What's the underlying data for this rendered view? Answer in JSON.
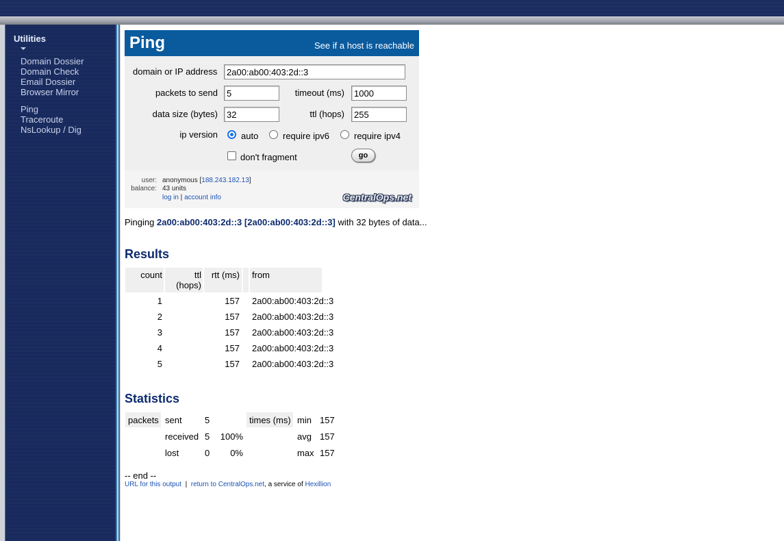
{
  "sidebar": {
    "heading": "Utilities",
    "group1": [
      "Domain Dossier",
      "Domain Check",
      "Email Dossier",
      "Browser Mirror"
    ],
    "group2": [
      "Ping",
      "Traceroute",
      "NsLookup / Dig"
    ]
  },
  "ping_form": {
    "title": "Ping",
    "tagline": "See if a host is reachable",
    "host_label": "domain or IP address",
    "host_value": "2a00:ab00:403:2d::3",
    "packets_label": "packets to send",
    "packets_value": "5",
    "timeout_label": "timeout (ms)",
    "timeout_value": "1000",
    "size_label": "data size (bytes)",
    "size_value": "32",
    "ttl_label": "ttl (hops)",
    "ttl_value": "255",
    "ipver_label": "ip version",
    "ipver_options": [
      "auto",
      "require ipv6",
      "require ipv4"
    ],
    "ipver_selected": "auto",
    "dontfrag_label": "don't fragment",
    "dontfrag_checked": false,
    "go_label": "go"
  },
  "user_panel": {
    "user_label": "user:",
    "user_name": "anonymous",
    "user_ip": "188.243.182.13",
    "balance_label": "balance:",
    "balance_value": "43 units",
    "login_link": "log in",
    "account_link": "account info",
    "logo_text": "CentralOps.net"
  },
  "pinging_line": {
    "prefix": "Pinging",
    "host": "2a00:ab00:403:2d::3",
    "addr": "[2a00:ab00:403:2d::3]",
    "suffix": "with 32 bytes of data..."
  },
  "results": {
    "title": "Results",
    "headers": {
      "count": "count",
      "ttl_1": "ttl",
      "ttl_2": "(hops)",
      "rtt": "rtt (ms)",
      "from": "from"
    },
    "rows": [
      {
        "count": "1",
        "rtt": "157",
        "from": "2a00:ab00:403:2d::3"
      },
      {
        "count": "2",
        "rtt": "157",
        "from": "2a00:ab00:403:2d::3"
      },
      {
        "count": "3",
        "rtt": "157",
        "from": "2a00:ab00:403:2d::3"
      },
      {
        "count": "4",
        "rtt": "157",
        "from": "2a00:ab00:403:2d::3"
      },
      {
        "count": "5",
        "rtt": "157",
        "from": "2a00:ab00:403:2d::3"
      }
    ]
  },
  "statistics": {
    "title": "Statistics",
    "packets_header": "packets",
    "times_header": "times (ms)",
    "sent_label": "sent",
    "sent_value": "5",
    "received_label": "received",
    "received_value": "5",
    "received_pct": "100%",
    "lost_label": "lost",
    "lost_value": "0",
    "lost_pct": "0%",
    "min_label": "min",
    "min_value": "157",
    "avg_label": "avg",
    "avg_value": "157",
    "max_label": "max",
    "max_value": "157"
  },
  "footer": {
    "end_text": "-- end --",
    "url_link": "URL for this output",
    "sep": "|",
    "return_link": "return to CentralOps.net",
    "service_text": ", a service of",
    "hexillion_link": "Hexillion"
  },
  "colors": {
    "header_blue": "#0a5a9e",
    "heading_navy": "#0d2a6e",
    "link_blue": "#1a52b3",
    "sidebar_navy": "#0f2050"
  }
}
